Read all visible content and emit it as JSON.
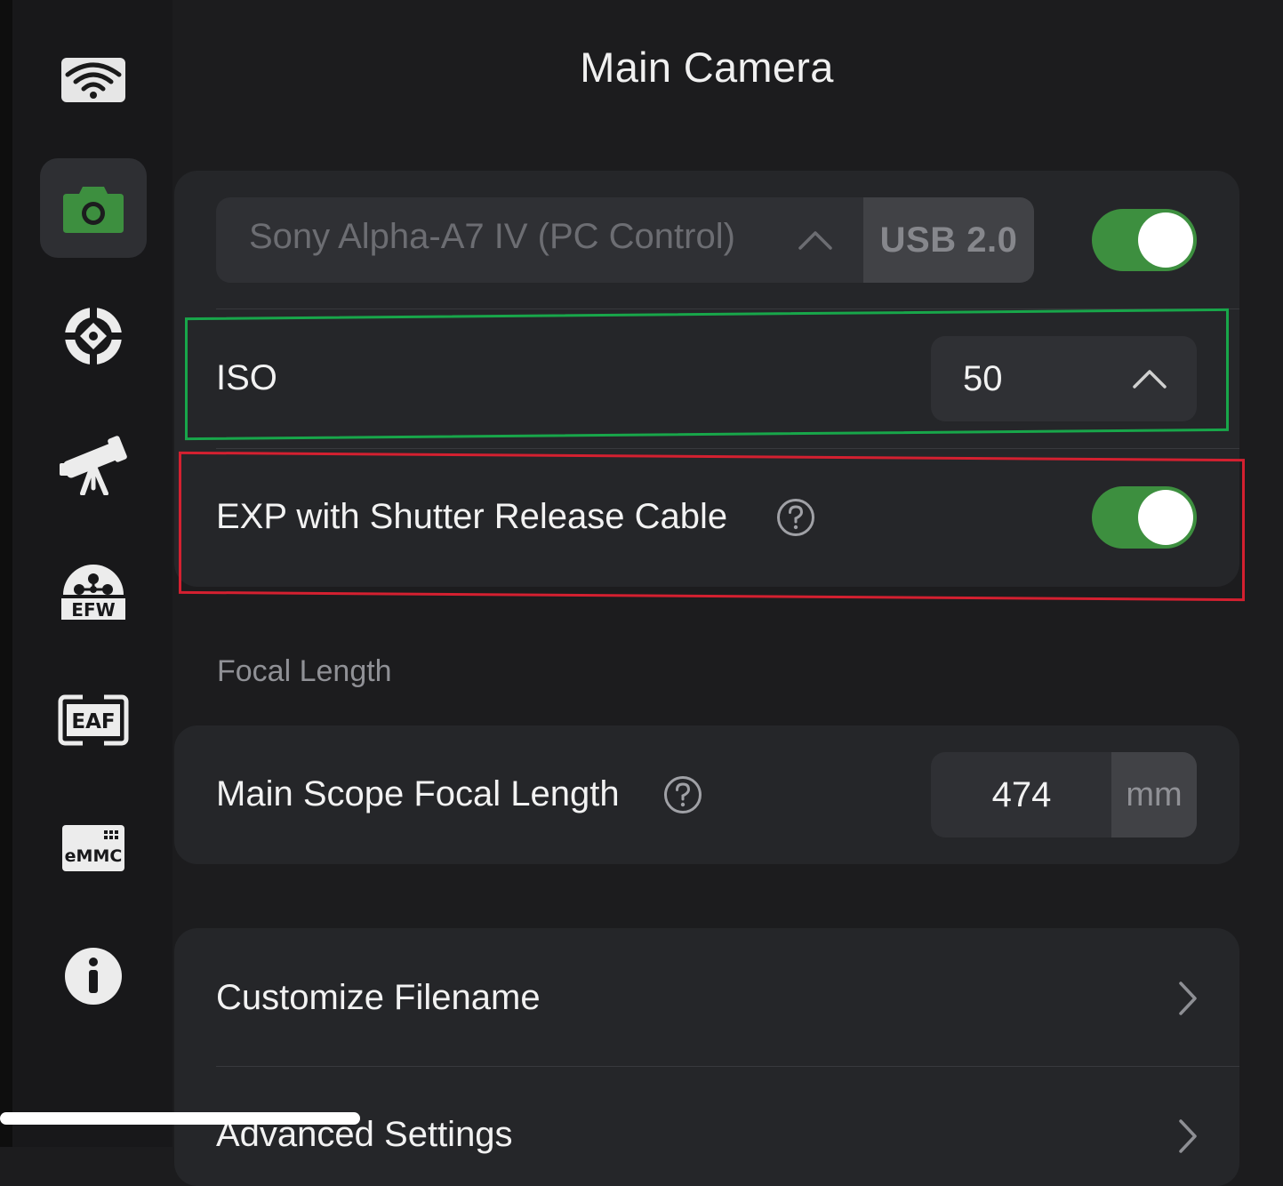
{
  "header": {
    "title": "Main Camera"
  },
  "sidebar": {
    "items": [
      {
        "icon": "wifi-icon",
        "active": false
      },
      {
        "icon": "camera-icon",
        "active": true
      },
      {
        "icon": "guide-target-icon",
        "active": false
      },
      {
        "icon": "telescope-icon",
        "active": false
      },
      {
        "icon": "efw-icon",
        "label": "EFW",
        "active": false
      },
      {
        "icon": "eaf-icon",
        "label": "EAF",
        "active": false
      },
      {
        "icon": "emmc-icon",
        "label": "eMMC",
        "active": false
      },
      {
        "icon": "info-icon",
        "active": false
      }
    ]
  },
  "camera": {
    "device_name": "Sony Alpha-A7 IV (PC Control)",
    "connection": "USB 2.0",
    "enabled": true
  },
  "iso": {
    "label": "ISO",
    "value": "50"
  },
  "exposure": {
    "label": "EXP with Shutter Release Cable",
    "enabled": true
  },
  "focal_section": {
    "heading": "Focal Length",
    "label": "Main Scope Focal Length",
    "value": "474",
    "unit": "mm"
  },
  "menu": {
    "items": [
      {
        "label": "Customize Filename"
      },
      {
        "label": "Advanced Settings"
      }
    ]
  },
  "colors": {
    "accent_green": "#3d8f3f",
    "highlight_green": "#18a64a",
    "highlight_red": "#d42030",
    "background": "#1c1c1e",
    "card": "#252629"
  }
}
